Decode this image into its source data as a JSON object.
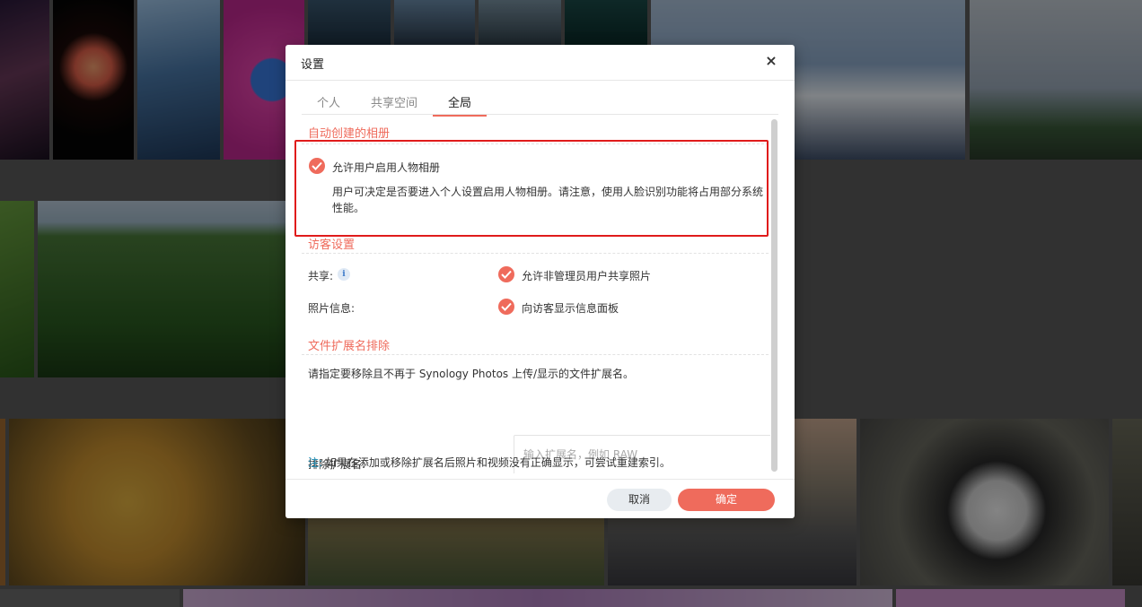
{
  "dialog": {
    "title": "设置",
    "close_icon": "×",
    "tabs": [
      {
        "label": "个人",
        "active": false
      },
      {
        "label": "共享空间",
        "active": false
      },
      {
        "label": "全局",
        "active": true
      }
    ]
  },
  "auto_album": {
    "title": "自动创建的相册",
    "person_album_checked": true,
    "person_album_label": "允许用户启用人物相册",
    "person_album_desc": "用户可决定是否要进入个人设置启用人物相册。请注意，使用人脸识别功能将占用部分系统性能。"
  },
  "visitor": {
    "title": "访客设置",
    "share_label": "共享:",
    "share_info_icon": "i",
    "share_option_checked": true,
    "share_option_label": "允许非管理员用户共享照片",
    "photo_info_label": "照片信息:",
    "photo_info_checked": true,
    "photo_info_option_label": "向访客显示信息面板"
  },
  "ext_exclude": {
    "title": "文件扩展名排除",
    "instruction": "请指定要移除且不再于 Synology Photos 上传/显示的文件扩展名。",
    "exclude_label": "排除扩展名:",
    "exclude_placeholder": "输入扩展名，例如 RAW",
    "note_label": "注:",
    "note_text": "如果在添加或移除扩展名后照片和视频没有正确显示，可尝试重建索引。"
  },
  "footer": {
    "cancel_label": "取消",
    "ok_label": "确定"
  },
  "colors": {
    "accent": "#ef6b5c",
    "highlight_border": "#e01b1b",
    "note": "#1f8fb7"
  }
}
